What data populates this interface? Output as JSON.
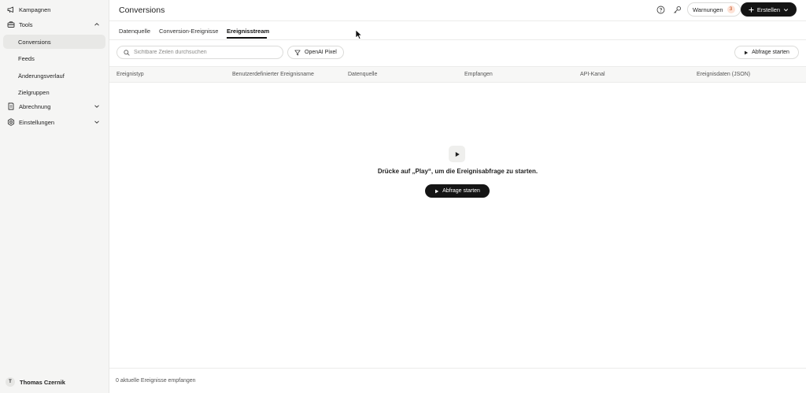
{
  "sidebar": {
    "items": [
      {
        "label": "Kampagnen",
        "icon": "megaphone-icon"
      },
      {
        "label": "Tools",
        "icon": "toolbox-icon",
        "expanded": true
      },
      {
        "label": "Abrechnung",
        "icon": "receipt-icon",
        "expanded": false
      },
      {
        "label": "Einstellungen",
        "icon": "gear-icon",
        "expanded": false
      }
    ],
    "tools_sub": [
      {
        "label": "Conversions",
        "active": true
      },
      {
        "label": "Feeds"
      },
      {
        "label": "Änderungsverlauf"
      },
      {
        "label": "Zielgruppen"
      }
    ],
    "user": {
      "initial": "T",
      "name": "Thomas Czernik"
    }
  },
  "header": {
    "title": "Conversions",
    "warnings_label": "Warnungen",
    "warnings_count": "3",
    "create_label": "Erstellen"
  },
  "tabs": [
    {
      "label": "Datenquelle"
    },
    {
      "label": "Conversion-Ereignisse"
    },
    {
      "label": "Ereignisstream",
      "active": true
    }
  ],
  "toolbar": {
    "search_placeholder": "Sichtbare Zeilen durchsuchen",
    "filter_label": "OpenAI Pixel",
    "run_label": "Abfrage starten"
  },
  "table": {
    "columns": [
      "Ereignistyp",
      "Benutzerdefinierter Ereignisname",
      "Datenquelle",
      "Empfangen",
      "API-Kanal",
      "Ereignisdaten (JSON)"
    ]
  },
  "empty_state": {
    "message": "Drücke auf „Play“, um die Ereignisabfrage zu starten.",
    "button_label": "Abfrage starten"
  },
  "footer": {
    "status": "0 aktuelle Ereignisse empfangen"
  },
  "colors": {
    "accent": "#151515",
    "sidebar_bg": "#f5f5f4",
    "warning_badge_bg": "#fde2d6",
    "warning_badge_text": "#c2410c"
  }
}
